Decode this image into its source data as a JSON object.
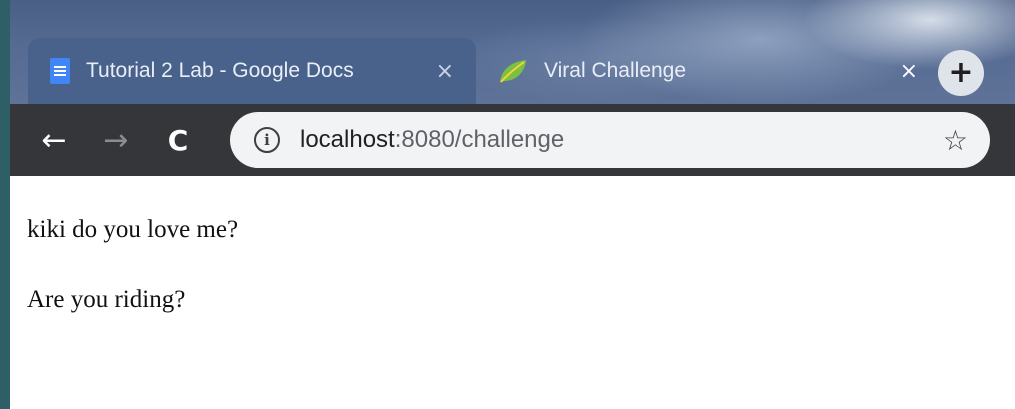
{
  "tabs": [
    {
      "title": "Tutorial 2 Lab - Google Docs",
      "icon": "google-docs-icon",
      "close": "×",
      "active": false
    },
    {
      "title": "Viral Challenge",
      "icon": "leaf-icon",
      "close": "×",
      "active": true
    }
  ],
  "new_tab": "+",
  "toolbar": {
    "back": "←",
    "forward": "→",
    "reload": "C",
    "address_host": "localhost",
    "address_rest": ":8080/challenge",
    "info": "i",
    "bookmark": "☆"
  },
  "page": {
    "lines": [
      "kiki do you love me?",
      "Are you riding?"
    ]
  },
  "colors": {
    "docs_blue": "#4285f4",
    "leaf_green": "#7ac143",
    "toolbar": "#35363a",
    "omnibox": "#f1f3f4"
  }
}
